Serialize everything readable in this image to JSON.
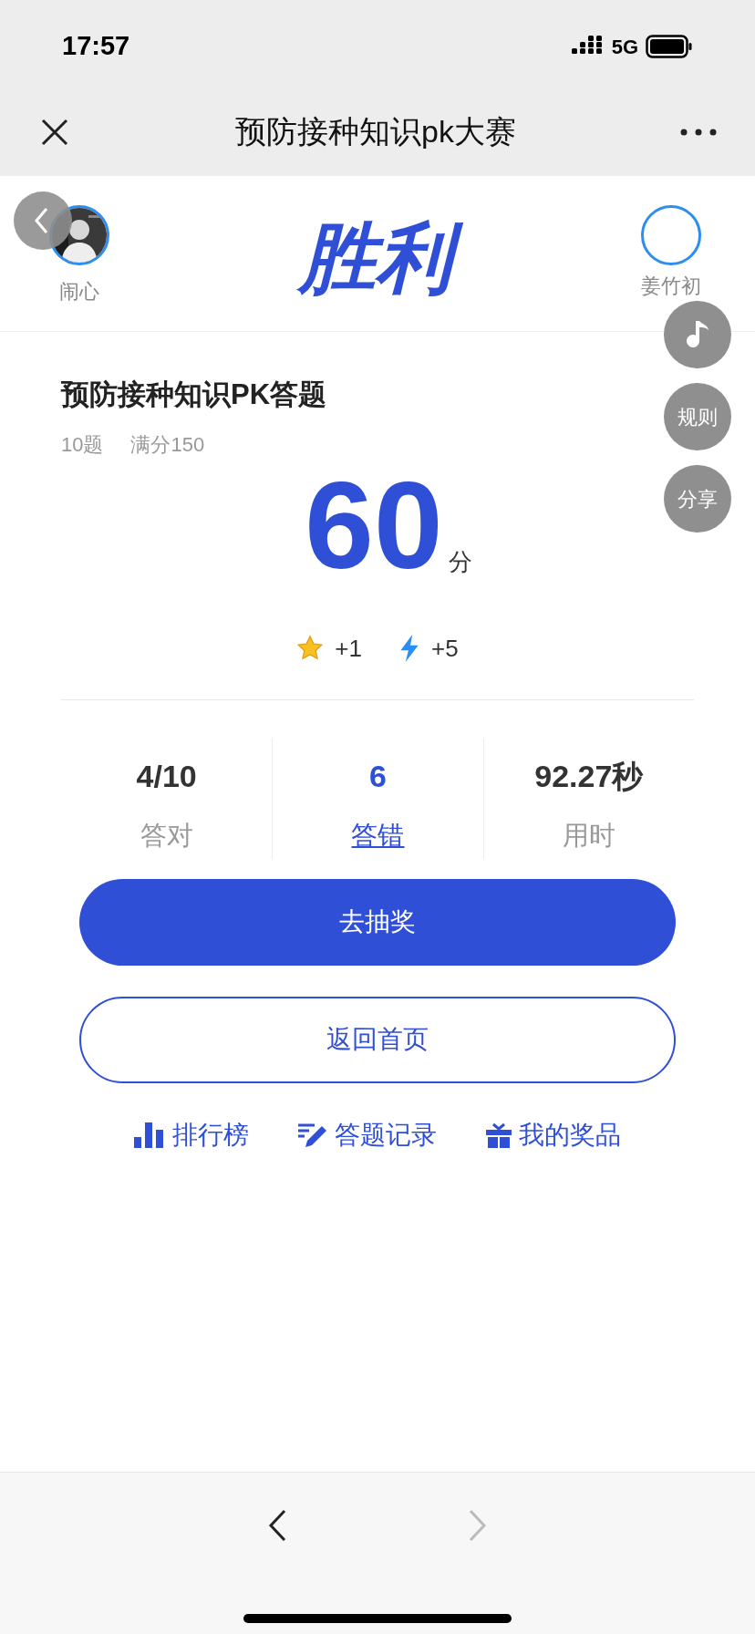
{
  "status_bar": {
    "time": "17:57",
    "network": "5G"
  },
  "nav_bar": {
    "title": "预防接种知识pk大赛"
  },
  "match": {
    "result": "胜利",
    "player": {
      "name": "闹心"
    },
    "opponent": {
      "name": "姜竹初"
    }
  },
  "side_buttons": [
    {
      "kind": "music"
    },
    {
      "kind": "text",
      "label": "规则"
    },
    {
      "kind": "text",
      "label": "分享"
    }
  ],
  "quiz": {
    "title": "预防接种知识PK答题",
    "question_count": "10题",
    "full_score": "满分150",
    "score": "60",
    "score_unit": "分"
  },
  "rewards": [
    {
      "kind": "star",
      "value": "+1"
    },
    {
      "kind": "bolt",
      "value": "+5"
    }
  ],
  "stats": [
    {
      "value": "4/10",
      "label": "答对",
      "link": false
    },
    {
      "value": "6",
      "label": "答错",
      "link": true
    },
    {
      "value": "92.27秒",
      "label": "用时",
      "link": false
    }
  ],
  "primary_button": "去抽奖",
  "secondary_button": "返回首页",
  "links": [
    {
      "kind": "ranking",
      "label": "排行榜"
    },
    {
      "kind": "records",
      "label": "答题记录"
    },
    {
      "kind": "prizes",
      "label": "我的奖品"
    }
  ]
}
